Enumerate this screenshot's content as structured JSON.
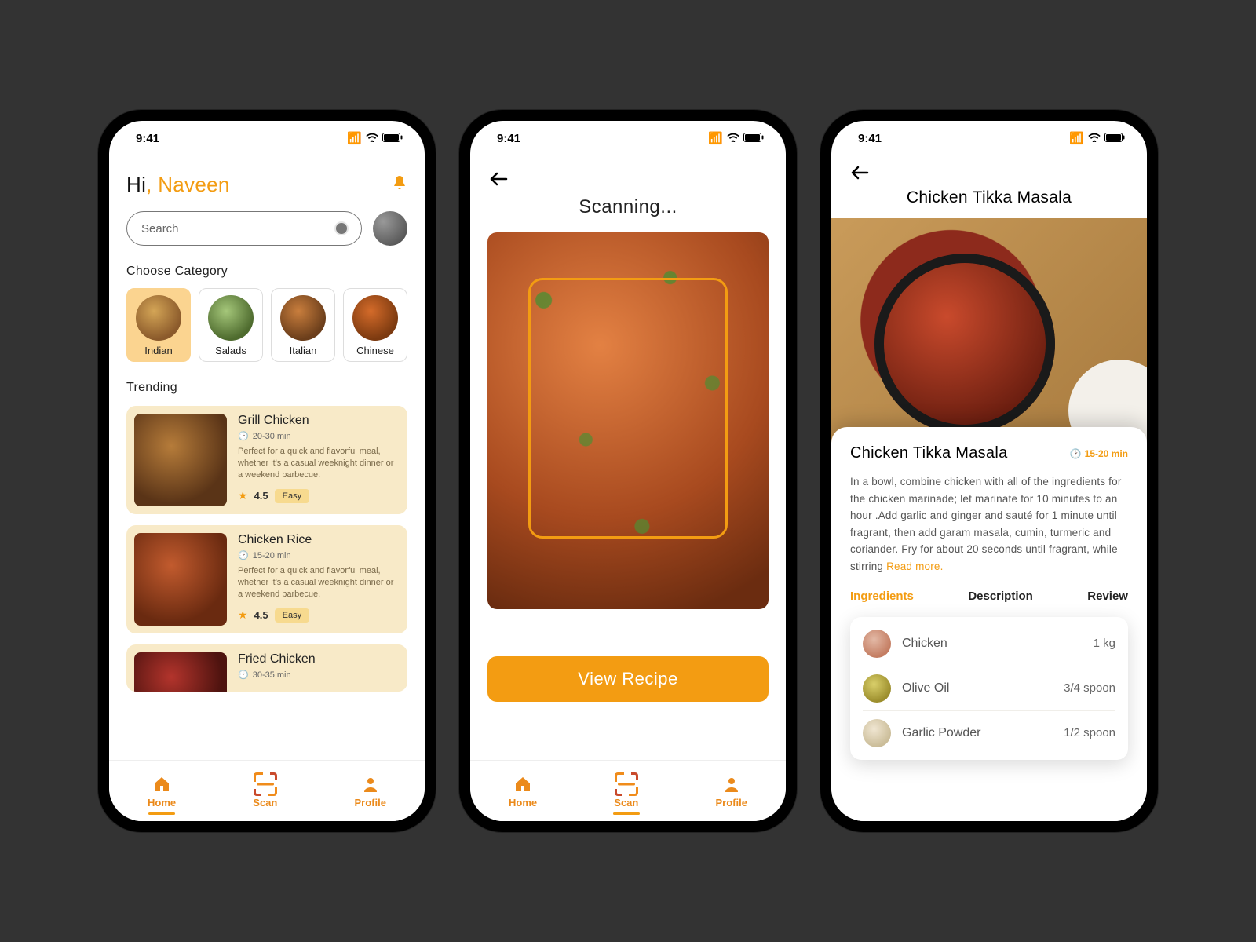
{
  "status": {
    "time": "9:41"
  },
  "screen1": {
    "greeting_hi": "Hi",
    "greeting_sep": ", ",
    "greeting_name": "Naveen",
    "search_placeholder": "Search",
    "choose_category": "Choose Category",
    "categories": [
      {
        "label": "Indian"
      },
      {
        "label": "Salads"
      },
      {
        "label": "Italian"
      },
      {
        "label": "Chinese"
      }
    ],
    "trending_label": "Trending",
    "trending": [
      {
        "title": "Grill Chicken",
        "time": "20-30 min",
        "desc": "Perfect for a quick and flavorful meal, whether it's a casual weeknight dinner or a weekend barbecue.",
        "rating": "4.5",
        "difficulty": "Easy"
      },
      {
        "title": "Chicken Rice",
        "time": "15-20 min",
        "desc": "Perfect for a quick and flavorful meal, whether it's a casual weeknight dinner or a weekend barbecue.",
        "rating": "4.5",
        "difficulty": "Easy"
      },
      {
        "title": "Fried Chicken",
        "time": "30-35 min",
        "desc": "",
        "rating": "",
        "difficulty": ""
      }
    ]
  },
  "nav": {
    "home": "Home",
    "scan": "Scan",
    "profile": "Profile"
  },
  "screen2": {
    "title": "Scanning...",
    "cta": "View Recipe"
  },
  "screen3": {
    "title": "Chicken Tikka Masala",
    "sheet_title": "Chicken Tikka Masala",
    "time": "15-20 min",
    "desc": "In a bowl, combine chicken with all of the ingredients for the chicken marinade; let marinate for 10 minutes to an hour .Add garlic and ginger and sauté for 1 minute until fragrant, then add garam masala, cumin, turmeric and coriander. Fry for about 20 seconds until fragrant, while stirring ",
    "readmore": "Read more.",
    "tabs": {
      "ingredients": "Ingredients",
      "description": "Description",
      "review": "Review"
    },
    "ingredients": [
      {
        "name": "Chicken",
        "amt": "1 kg"
      },
      {
        "name": "Olive Oil",
        "amt": "3/4 spoon"
      },
      {
        "name": "Garlic Powder",
        "amt": "1/2 spoon"
      }
    ]
  }
}
